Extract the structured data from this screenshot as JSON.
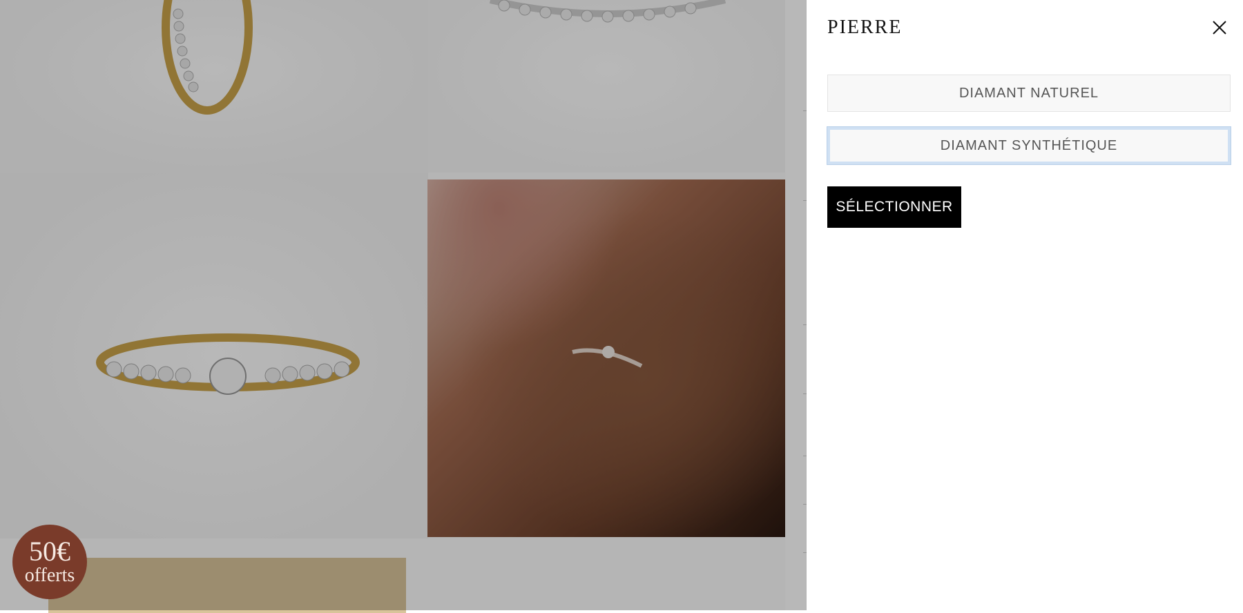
{
  "drawer": {
    "title": "PIERRE",
    "options": [
      {
        "label": "DIAMANT NATUREL"
      },
      {
        "label": "DIAMANT SYNTHÉTIQUE"
      }
    ],
    "select_label": "SÉLECTIONNER"
  },
  "promo": {
    "amount": "50€",
    "text": "offerts"
  },
  "colors": {
    "promo_badge": "#7a3b2a",
    "select_button": "#000000",
    "option_bg": "#f8f8f8",
    "focus_ring": "#cfe0f3"
  }
}
